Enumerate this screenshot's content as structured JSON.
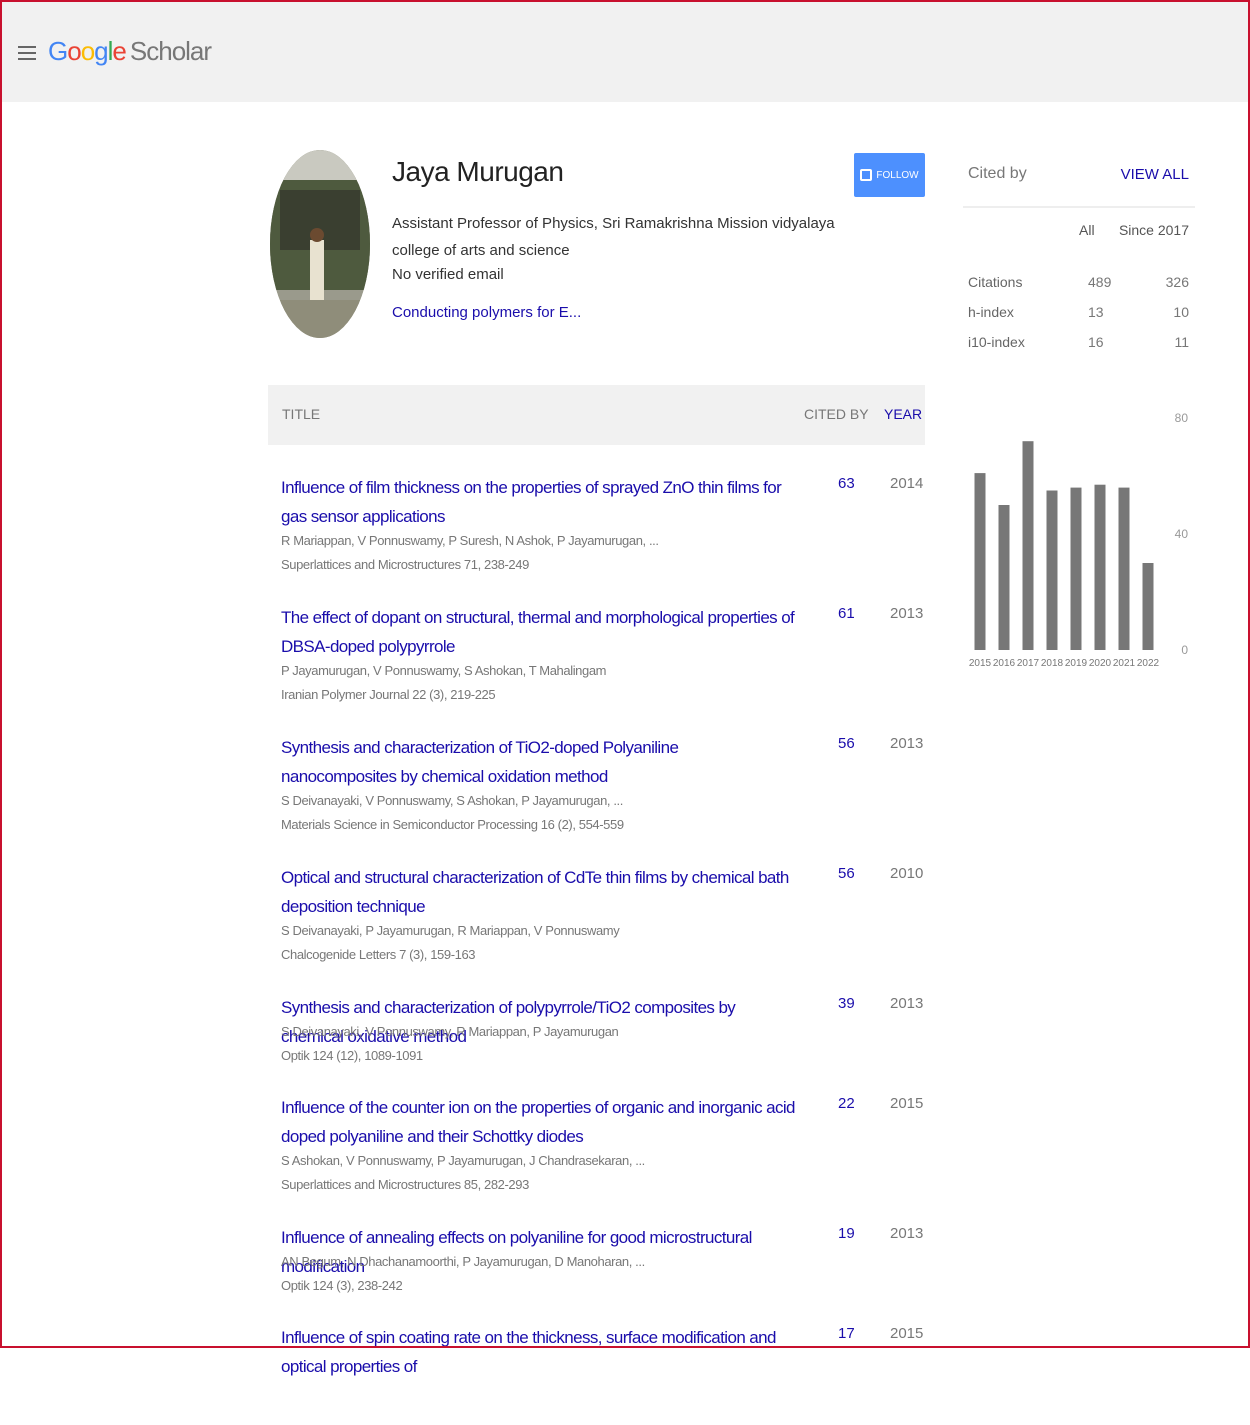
{
  "header": {
    "logo": {
      "g": [
        "G",
        "o",
        "o",
        "g",
        "l",
        "e"
      ],
      "scholar": "Scholar"
    },
    "menu_icon": "hamburger-menu-icon"
  },
  "profile": {
    "name": "Jaya Murugan",
    "affiliation": "Assistant Professor of Physics, Sri Ramakrishna Mission vidyalaya college of arts and science",
    "email": "No verified email",
    "interest": "Conducting polymers for E...",
    "follow_label": "FOLLOW"
  },
  "table": {
    "headers": {
      "title": "TITLE",
      "cited_by": "CITED BY",
      "year": "YEAR"
    },
    "rows": [
      {
        "title": "Influence of film thickness on the properties of sprayed ZnO thin films for gas sensor applications",
        "authors": "R Mariappan, V Ponnuswamy, P Suresh, N Ashok, P Jayamurugan, ...",
        "venue": "Superlattices and Microstructures 71, 238-249",
        "cites": "63",
        "year": "2014"
      },
      {
        "title": "The effect of dopant on structural, thermal and morphological properties of DBSA-doped polypyrrole",
        "authors": "P Jayamurugan, V Ponnuswamy, S Ashokan, T Mahalingam",
        "venue": "Iranian Polymer Journal 22 (3), 219-225",
        "cites": "61",
        "year": "2013"
      },
      {
        "title": "Synthesis and characterization of TiO2-doped Polyaniline nanocomposites by chemical oxidation method",
        "authors": "S Deivanayaki, V Ponnuswamy, S Ashokan, P Jayamurugan, ...",
        "venue": "Materials Science in Semiconductor Processing 16 (2), 554-559",
        "cites": "56",
        "year": "2013"
      },
      {
        "title": "Optical and structural characterization of CdTe thin films by chemical bath deposition technique",
        "authors": "S Deivanayaki, P Jayamurugan, R Mariappan, V Ponnuswamy",
        "venue": "Chalcogenide Letters 7 (3), 159-163",
        "cites": "56",
        "year": "2010"
      },
      {
        "title": "Synthesis and characterization of polypyrrole/TiO2 composites by chemical oxidative method",
        "authors": "S Deivanayaki, V Ponnuswamy, R Mariappan, P Jayamurugan",
        "venue": "Optik 124 (12), 1089-1091",
        "cites": "39",
        "year": "2013"
      },
      {
        "title": "Influence of the counter ion on the properties of organic and inorganic acid doped polyaniline and their Schottky diodes",
        "authors": "S Ashokan, V Ponnuswamy, P Jayamurugan, J Chandrasekaran, ...",
        "venue": "Superlattices and Microstructures 85, 282-293",
        "cites": "22",
        "year": "2015"
      },
      {
        "title": "Influence of annealing effects on polyaniline for good microstructural modification",
        "authors": "AN Begum, N Dhachanamoorthi, P Jayamurugan, D Manoharan, ...",
        "venue": "Optik 124 (3), 238-242",
        "cites": "19",
        "year": "2013"
      },
      {
        "title": "Influence of spin coating rate on the thickness, surface modification and optical properties of",
        "authors": "",
        "venue": "",
        "cites": "17",
        "year": "2015"
      }
    ]
  },
  "cited_by": {
    "title": "Cited by",
    "view_all": "VIEW ALL",
    "col_all": "All",
    "col_since": "Since 2017",
    "stats": [
      {
        "label": "Citations",
        "all": "489",
        "since": "326"
      },
      {
        "label": "h-index",
        "all": "13",
        "since": "10"
      },
      {
        "label": "i10-index",
        "all": "16",
        "since": "11"
      }
    ]
  },
  "chart_data": {
    "type": "bar",
    "categories": [
      "2015",
      "2016",
      "2017",
      "2018",
      "2019",
      "2020",
      "2021",
      "2022"
    ],
    "values": [
      61,
      50,
      72,
      55,
      56,
      57,
      56,
      30
    ],
    "ylim": [
      0,
      80
    ],
    "yticks": [
      "0",
      "40",
      "80"
    ],
    "bar_color": "#777777"
  }
}
